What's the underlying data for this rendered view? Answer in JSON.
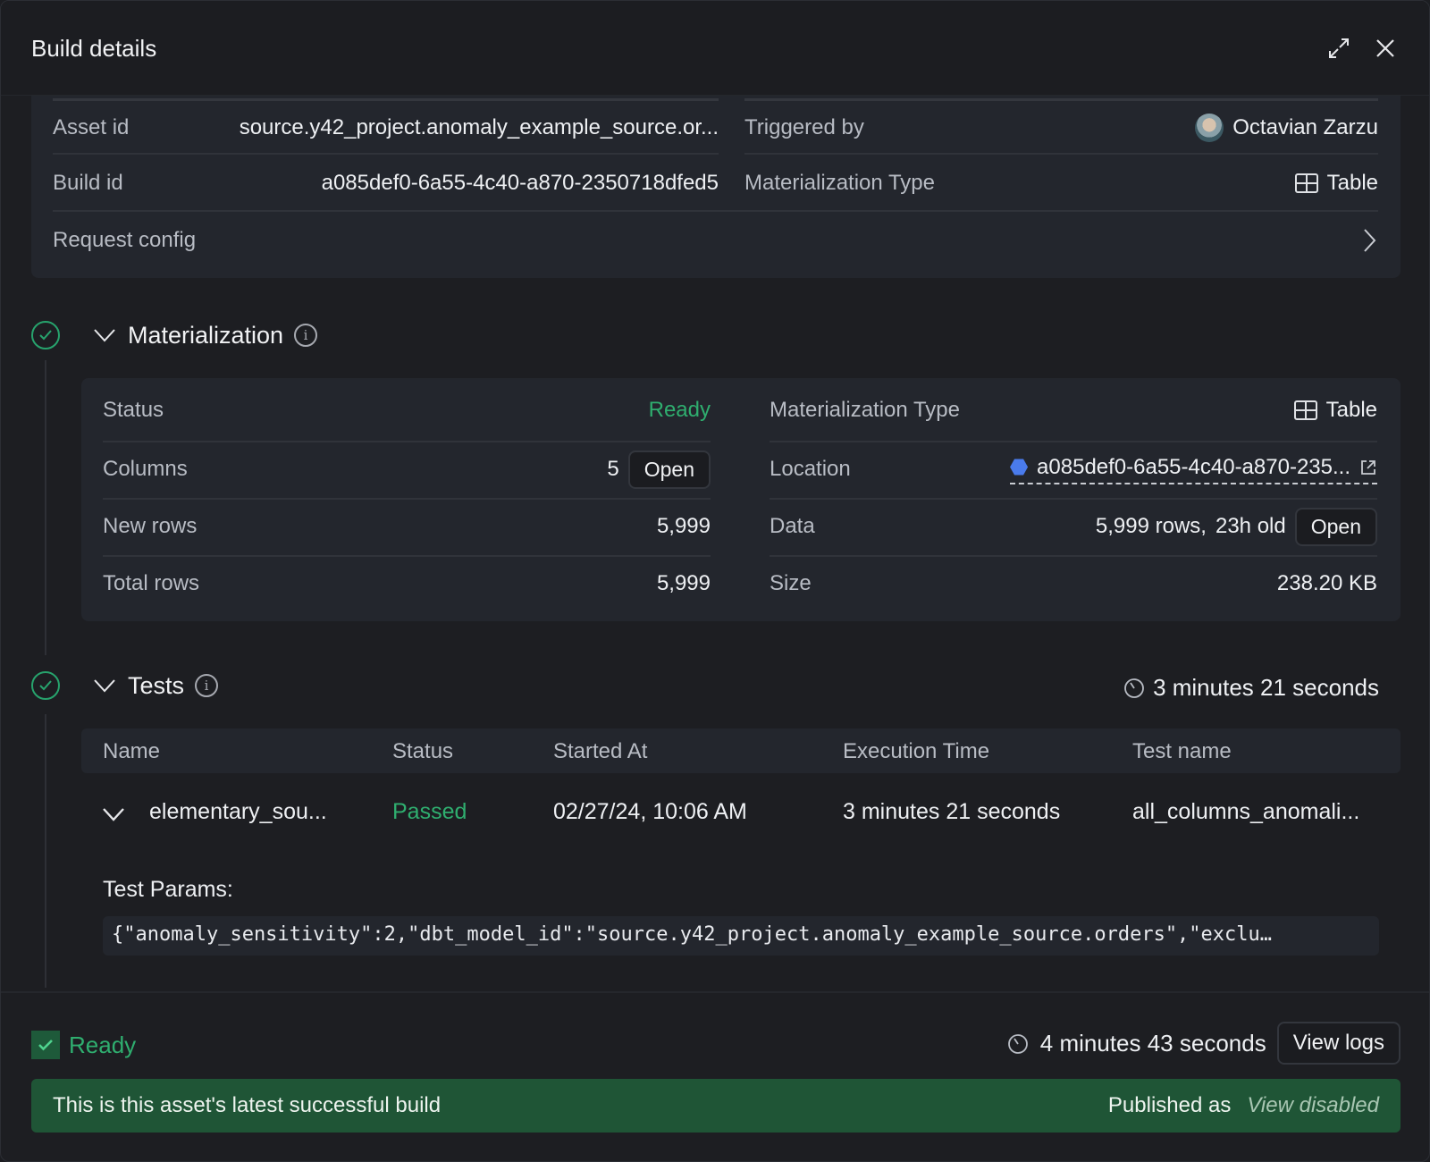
{
  "header": {
    "title": "Build details",
    "expand_icon": "expand-arrows-icon",
    "close_icon": "close-x-icon"
  },
  "info": {
    "asset_id_label": "Asset id",
    "asset_id_value": "source.y42_project.anomaly_example_source.or...",
    "build_id_label": "Build id",
    "build_id_value": "a085def0-6a55-4c40-a870-2350718dfed5",
    "request_config_label": "Request config",
    "triggered_by_label": "Triggered by",
    "triggered_by_value": "Octavian Zarzu",
    "materialization_type_label": "Materialization Type",
    "materialization_type_value": "Table"
  },
  "materialization": {
    "title": "Materialization",
    "status_label": "Status",
    "status_value": "Ready",
    "columns_label": "Columns",
    "columns_value": "5",
    "columns_button": "Open",
    "new_rows_label": "New rows",
    "new_rows_value": "5,999",
    "total_rows_label": "Total rows",
    "total_rows_value": "5,999",
    "type_label": "Materialization Type",
    "type_value": "Table",
    "location_label": "Location",
    "location_value": "a085def0-6a55-4c40-a870-235...",
    "data_label": "Data",
    "data_rows": "5,999 rows,",
    "data_age": "23h old",
    "data_button": "Open",
    "size_label": "Size",
    "size_value": "238.20 KB"
  },
  "tests": {
    "title": "Tests",
    "duration": "3 minutes 21 seconds",
    "columns": [
      "Name",
      "Status",
      "Started At",
      "Execution Time",
      "Test name"
    ],
    "rows": [
      {
        "name": "elementary_sou...",
        "status": "Passed",
        "started_at": "02/27/24, 10:06 AM",
        "execution_time": "3 minutes 21 seconds",
        "test_name": "all_columns_anomali..."
      }
    ],
    "params_label": "Test Params:",
    "params_value": "{\"anomaly_sensitivity\":2,\"dbt_model_id\":\"source.y42_project.anomaly_example_source.orders\",\"exclu…"
  },
  "footer": {
    "status": "Ready",
    "duration": "4 minutes 43 seconds",
    "view_logs_button": "View logs",
    "banner_text": "This is this asset's latest successful build",
    "published_label": "Published as",
    "published_value": "View disabled"
  },
  "colors": {
    "success": "#2fae6f",
    "banner": "#1f5536",
    "background": "#1d1e22",
    "card": "#23262d"
  }
}
